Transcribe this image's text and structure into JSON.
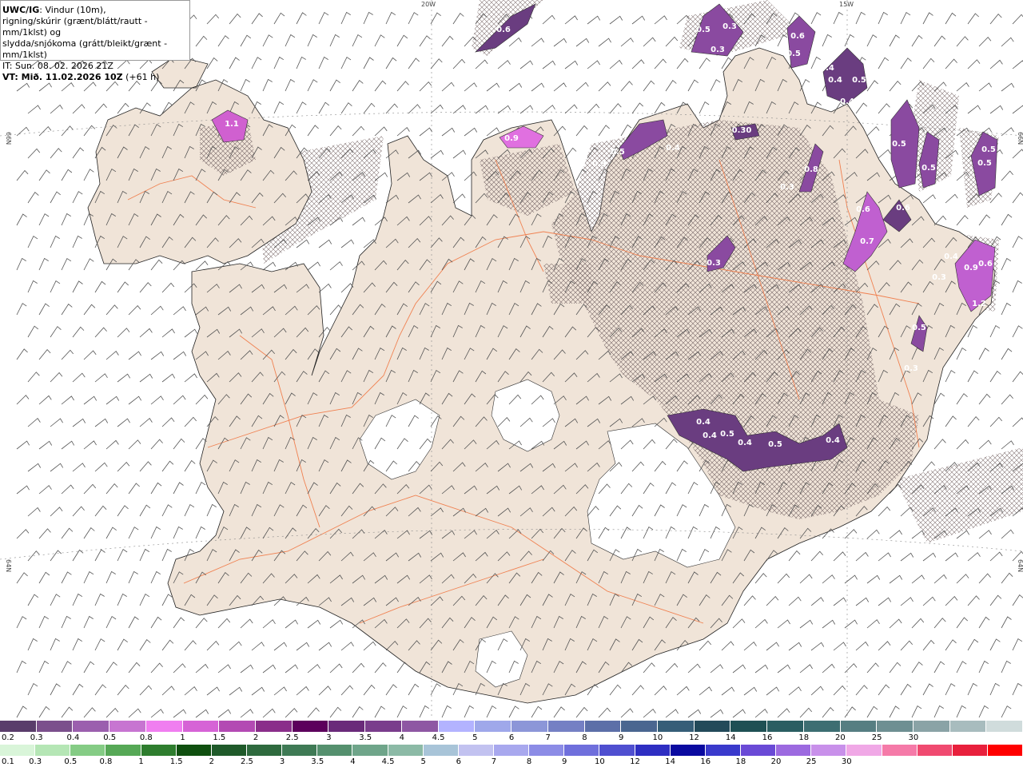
{
  "header": {
    "product": "UWC/IG",
    "line1_rest": ": Vindur (10m),",
    "line2": "rigning/skúrir (grænt/blátt/rautt - mm/1klst) og",
    "line3": "slydda/snjókoma (grátt/bleikt/grænt - mm/1klst)",
    "line4": "IT: Sun. 08. 02. 2026 21Z",
    "line5_label": "VT: Mið. 11.02.2026 10Z",
    "line5_rest": " (+61 h)"
  },
  "graticule": {
    "top_labels": [
      "20W",
      "15W"
    ],
    "side_labels": [
      "66N",
      "64N"
    ]
  },
  "precip_labels": [
    "0.6",
    "0.5",
    "0.3",
    "0.3",
    "0.6",
    "0.5",
    "0.4",
    "0.4",
    "0.5",
    "0.4",
    "1.1",
    "0.9",
    "0.5",
    "0.4",
    "0.3",
    "0.30",
    "0.8",
    "0.3",
    "0.5",
    "0.5",
    "0.5",
    "0.5",
    "0.6",
    "0.7",
    "0.6",
    "0.3",
    "0.4",
    "0.9",
    "0.3",
    "0.6",
    "1.2",
    "0.5",
    "0.4",
    "0.4",
    "0.5",
    "0.4",
    "0.5",
    "0.4",
    "0.3"
  ],
  "legend": {
    "snow_colors": [
      "#5a3d6b",
      "#7b4f8c",
      "#9b5fae",
      "#c775d1",
      "#f07ef0",
      "#d663d6",
      "#b34ab3",
      "#8a2e8a",
      "#5c005c",
      "#6a2a7a",
      "#7a3d8c",
      "#8e57a3",
      "#b3b3ff",
      "#9fa8ea",
      "#8c96d8",
      "#7580c4",
      "#5c6fa8",
      "#4a6690",
      "#365e78",
      "#234a5a",
      "#1e5054",
      "#2a5e62",
      "#3d6e72",
      "#567e82",
      "#6e8f92",
      "#8aa3a6",
      "#a8bcbe",
      "#d0dcdc"
    ],
    "snow_labels": [
      "0.2",
      "0.3",
      "0.4",
      "0.5",
      "0.8",
      "1",
      "1.5",
      "2",
      "2.5",
      "3",
      "3.5",
      "4",
      "4.5",
      "5",
      "6",
      "7",
      "8",
      "9",
      "10",
      "12",
      "14",
      "16",
      "18",
      "20",
      "25",
      "30"
    ],
    "rain_colors": [
      "#d9f5d9",
      "#b5e6b5",
      "#85cc85",
      "#56a856",
      "#2e7d2e",
      "#0f4f0f",
      "#1f5a2a",
      "#2e6a3e",
      "#3f7a55",
      "#55906e",
      "#6fa58a",
      "#8cbaa6",
      "#a8c4d8",
      "#c2c2f0",
      "#a8a8ee",
      "#8c8ce6",
      "#6f6fdc",
      "#4f4fd0",
      "#2e2ec2",
      "#0a0aa0",
      "#3a3acc",
      "#6a4ad6",
      "#9c6ae0",
      "#c890ea",
      "#f0a8e6",
      "#f57aa8",
      "#f04a70",
      "#e8203c",
      "#ff0000"
    ],
    "rain_labels": [
      "0.1",
      "0.3",
      "0.5",
      "0.8",
      "1",
      "1.5",
      "2",
      "2.5",
      "3",
      "3.5",
      "4",
      "4.5",
      "5",
      "6",
      "7",
      "8",
      "9",
      "10",
      "12",
      "14",
      "16",
      "18",
      "20",
      "25",
      "30"
    ],
    "colors": {
      "land": "#f0e4d8",
      "ice": "#ffffff",
      "roads": "#f08050",
      "hatch": "#8a7a7a",
      "snow_dark": "#6a3d80",
      "snow_mid": "#a050c0",
      "snow_bright": "#e070e0"
    }
  }
}
